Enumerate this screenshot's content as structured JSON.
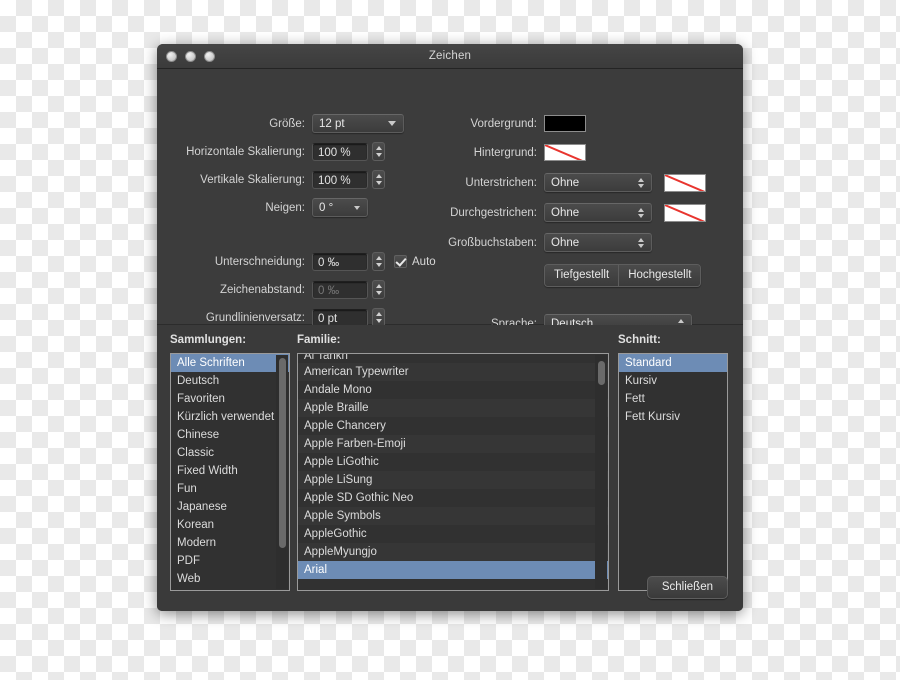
{
  "window": {
    "title": "Zeichen",
    "traffic_lights": [
      "close-button",
      "minimize-button",
      "zoom-button"
    ]
  },
  "form": {
    "left": [
      {
        "label": "Größe:",
        "value": "12 pt",
        "control": "popup"
      },
      {
        "label": "Horizontale Skalierung:",
        "value": "100 %",
        "control": "stepper-field"
      },
      {
        "label": "Vertikale Skalierung:",
        "value": "100 %",
        "control": "stepper-field"
      },
      {
        "label": "Neigen:",
        "value": "0 °",
        "control": "popup-small"
      },
      {
        "label": "Unterschneidung:",
        "value": "0 ‰",
        "control": "stepper-field",
        "checkbox": "Auto",
        "checked": true
      },
      {
        "label": "Zeichenabstand:",
        "value": "0 ‰",
        "control": "stepper-field",
        "disabled": true
      },
      {
        "label": "Grundlinienversatz:",
        "value": "0 pt",
        "control": "stepper-field"
      }
    ],
    "right": [
      {
        "label": "Vordergrund:",
        "control": "color-swatch",
        "color": "#000000"
      },
      {
        "label": "Hintergrund:",
        "control": "color-swatch",
        "color": "none"
      },
      {
        "label": "Unterstrichen:",
        "control": "popup",
        "value": "Ohne",
        "swatch": "none"
      },
      {
        "label": "Durchgestrichen:",
        "control": "popup",
        "value": "Ohne",
        "swatch": "none"
      },
      {
        "label": "Großbuchstaben:",
        "control": "popup",
        "value": "Ohne"
      }
    ],
    "segmented": [
      "Tiefgestellt",
      "Hochgestellt"
    ],
    "language": {
      "label": "Sprache:",
      "value": "Deutsch"
    }
  },
  "font_browser": {
    "headings": {
      "collections": "Sammlungen:",
      "family": "Familie:",
      "typeface": "Schnitt:"
    },
    "collections": [
      {
        "label": "Alle Schriften",
        "selected": true
      },
      {
        "label": "Deutsch"
      },
      {
        "label": "Favoriten"
      },
      {
        "label": "Kürzlich verwendet"
      },
      {
        "label": "Chinese"
      },
      {
        "label": "Classic"
      },
      {
        "label": "Fixed Width"
      },
      {
        "label": "Fun"
      },
      {
        "label": "Japanese"
      },
      {
        "label": "Korean"
      },
      {
        "label": "Modern"
      },
      {
        "label": "PDF"
      },
      {
        "label": "Web"
      }
    ],
    "families": [
      {
        "label": "Al Tarikh",
        "clipped": true
      },
      {
        "label": "American Typewriter"
      },
      {
        "label": "Andale Mono"
      },
      {
        "label": "Apple Braille"
      },
      {
        "label": "Apple Chancery"
      },
      {
        "label": "Apple Farben-Emoji"
      },
      {
        "label": "Apple LiGothic"
      },
      {
        "label": "Apple LiSung"
      },
      {
        "label": "Apple SD Gothic Neo"
      },
      {
        "label": "Apple Symbols"
      },
      {
        "label": "AppleGothic"
      },
      {
        "label": "AppleMyungjo"
      },
      {
        "label": "Arial",
        "selected": true
      }
    ],
    "typefaces": [
      {
        "label": "Standard",
        "selected": true
      },
      {
        "label": "Kursiv"
      },
      {
        "label": "Fett"
      },
      {
        "label": "Fett Kursiv"
      }
    ]
  },
  "footer": {
    "close_label": "Schließen"
  },
  "colors": {
    "selection": "#6d8cb5",
    "window_bg": "#3a3a3a",
    "panel_bg": "#3c3c3c",
    "list_bg": "#313131",
    "none_indicator": "#e8352f"
  }
}
